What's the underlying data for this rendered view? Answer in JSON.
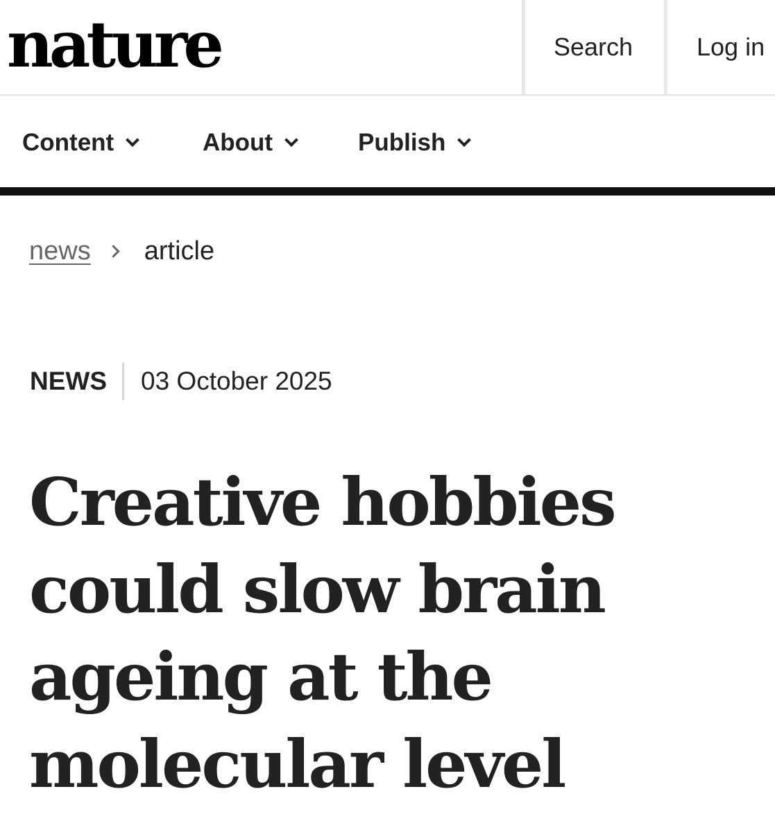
{
  "header": {
    "logo": "nature",
    "search_label": "Search",
    "login_label": "Log in"
  },
  "nav": {
    "items": [
      {
        "label": "Content"
      },
      {
        "label": "About"
      },
      {
        "label": "Publish"
      }
    ]
  },
  "breadcrumb": {
    "items": [
      {
        "label": "news"
      },
      {
        "label": "article"
      }
    ]
  },
  "article": {
    "type": "NEWS",
    "date": "03 October 2025",
    "title": "Creative hobbies could slow brain ageing at the molecular level"
  }
}
